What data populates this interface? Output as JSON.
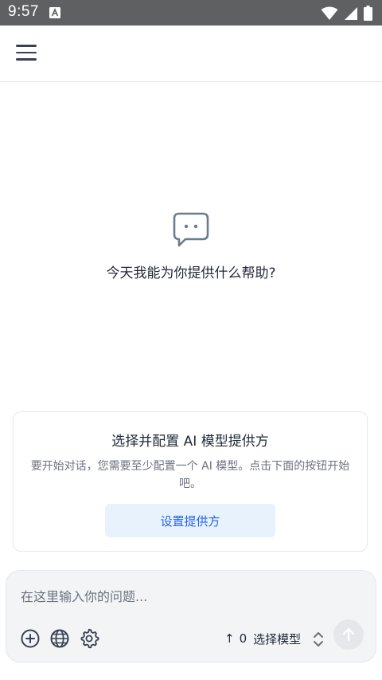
{
  "status_bar": {
    "time": "9:57",
    "notification_icon": "a-box-icon",
    "icons": [
      "wifi-icon",
      "signal-icon",
      "battery-icon"
    ]
  },
  "app_bar": {
    "menu_icon": "hamburger-menu-icon"
  },
  "empty_state": {
    "icon": "chat-bubble-icon",
    "text": "今天我能为你提供什么帮助?"
  },
  "setup_card": {
    "title": "选择并配置 AI 模型提供方",
    "description": "要开始对话，您需要至少配置一个 AI 模型。点击下面的按钮开始吧。",
    "button_label": "设置提供方"
  },
  "composer": {
    "placeholder": "在这里输入你的问题...",
    "tools": [
      "add-icon",
      "globe-icon",
      "settings-icon"
    ],
    "model_count_prefix": "↑",
    "model_count": "0",
    "model_select_label": "选择模型",
    "send_icon": "arrow-up-icon"
  },
  "colors": {
    "status_bar": "#5f6062",
    "accent": "#2563eb",
    "card_button_bg": "#e8f2fc",
    "composer_bg": "#f3f4f6"
  }
}
